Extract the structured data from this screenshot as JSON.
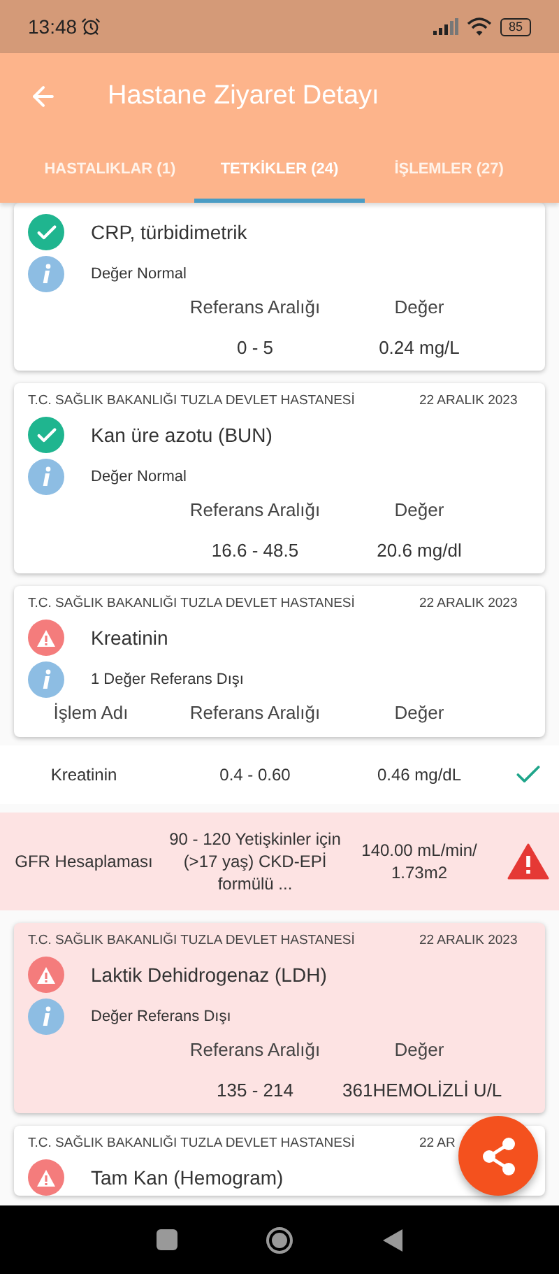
{
  "status_bar": {
    "time": "13:48",
    "battery": "85"
  },
  "app_bar": {
    "title": "Hastane Ziyaret Detayı"
  },
  "tabs": [
    {
      "label": "HASTALIKLAR (1)",
      "selected": false
    },
    {
      "label": "TETKİKLER (24)",
      "selected": true
    },
    {
      "label": "İŞLEMLER (27)",
      "selected": false
    }
  ],
  "tests": [
    {
      "normal": true,
      "highlighted": false,
      "name": "CRP, türbidimetrik",
      "note": "Değer Normal",
      "columns": [
        "Referans Aralığı",
        "Değer"
      ],
      "rows": [
        {
          "range": "0 - 5",
          "value": "0.24 mg/L"
        }
      ]
    },
    {
      "hospital": "T.C. SAĞLIK BAKANLIĞI TUZLA DEVLET HASTANESİ",
      "date": "22 ARALIK 2023",
      "normal": true,
      "highlighted": false,
      "name": "Kan üre azotu (BUN)",
      "note": "Değer Normal",
      "columns": [
        "Referans Aralığı",
        "Değer"
      ],
      "rows": [
        {
          "range": "16.6 - 48.5",
          "value": "20.6 mg/dl"
        }
      ]
    },
    {
      "hospital": "T.C. SAĞLIK BAKANLIĞI TUZLA DEVLET HASTANESİ",
      "date": "22 ARALIK 2023",
      "normal": false,
      "highlighted": false,
      "name": "Kreatinin",
      "note": "1 Değer Referans Dışı",
      "columns": [
        "İşlem Adı",
        "Referans Aralığı",
        "Değer"
      ],
      "sub_rows": [
        {
          "name": "Kreatinin",
          "range": "0.4 - 0.60",
          "value": "0.46 mg/dL",
          "normal": true,
          "highlighted": false
        },
        {
          "name": "GFR Hesaplaması",
          "range": "90 - 120 Yetişkinler için (>17 yaş) CKD-EPİ formülü ...",
          "value": "140.00 mL/min/ 1.73m2",
          "normal": false,
          "highlighted": true
        }
      ]
    },
    {
      "hospital": "T.C. SAĞLIK BAKANLIĞI TUZLA DEVLET HASTANESİ",
      "date": "22 ARALIK 2023",
      "normal": false,
      "highlighted": true,
      "name": "Laktik Dehidrogenaz (LDH)",
      "note": "Değer Referans Dışı",
      "columns": [
        "Referans Aralığı",
        "Değer"
      ],
      "rows": [
        {
          "range": "135 - 214",
          "value": "361HEMOLİZLİ U/L"
        }
      ]
    },
    {
      "hospital": "T.C. SAĞLIK BAKANLIĞI TUZLA DEVLET HASTANESİ",
      "date": "22 AR",
      "normal": false,
      "highlighted": false,
      "name": "Tam Kan (Hemogram)"
    }
  ]
}
